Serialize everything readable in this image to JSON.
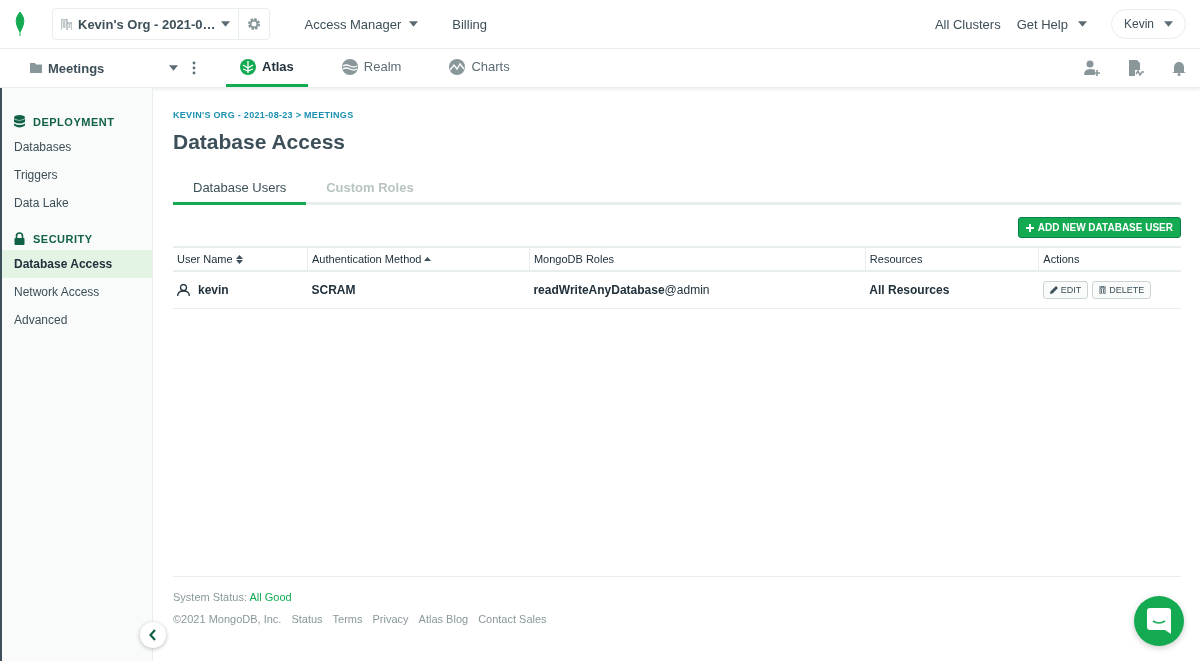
{
  "top_bar": {
    "org_selector": "Kevin's Org - 2021-0…",
    "nav": [
      {
        "label": "Access Manager",
        "dropdown": true
      },
      {
        "label": "Billing",
        "dropdown": false
      }
    ],
    "all_clusters": "All Clusters",
    "help": "Get Help",
    "user": "Kevin"
  },
  "project_bar": {
    "project": "Meetings",
    "products": [
      {
        "label": "Atlas",
        "kind": "atlas",
        "selected": true
      },
      {
        "label": "Realm",
        "kind": "realm",
        "selected": false
      },
      {
        "label": "Charts",
        "kind": "charts",
        "selected": false
      }
    ]
  },
  "sidebar": {
    "sections": [
      {
        "title": "DEPLOYMENT",
        "kind": "database",
        "items": [
          {
            "label": "Databases",
            "selected": false
          },
          {
            "label": "Triggers",
            "selected": false
          },
          {
            "label": "Data Lake",
            "selected": false
          }
        ]
      },
      {
        "title": "SECURITY",
        "kind": "lock",
        "items": [
          {
            "label": "Database Access",
            "selected": true
          },
          {
            "label": "Network Access",
            "selected": false
          },
          {
            "label": "Advanced",
            "selected": false
          }
        ]
      }
    ]
  },
  "breadcrumb": "KEVIN'S ORG - 2021-08-23 > MEETINGS",
  "title": "Database Access",
  "tabs": [
    {
      "label": "Database Users",
      "selected": true
    },
    {
      "label": "Custom Roles",
      "selected": false
    }
  ],
  "add_button": "ADD NEW DATABASE USER",
  "table": {
    "columns": [
      {
        "label": "User Name",
        "kind": "sortable"
      },
      {
        "label": "Authentication Method",
        "kind": "ascending"
      },
      {
        "label": "MongoDB Roles",
        "kind": "plain"
      },
      {
        "label": "Resources",
        "kind": "plain"
      },
      {
        "label": "Actions",
        "kind": "plain"
      }
    ],
    "rows": [
      {
        "user": "kevin",
        "method": "SCRAM",
        "roles": "**readWriteAnyDatabase**@admin",
        "resources": "All Resources",
        "actions": [
          {
            "label": "EDIT",
            "kind": "edit"
          },
          {
            "label": "DELETE",
            "kind": "delete"
          }
        ]
      }
    ]
  },
  "footer": {
    "status_label": "System Status:",
    "status_value": "All Good",
    "copyright": "©2021 MongoDB, Inc.",
    "links": [
      "Status",
      "Terms",
      "Privacy",
      "Atlas Blog",
      "Contact Sales"
    ]
  }
}
